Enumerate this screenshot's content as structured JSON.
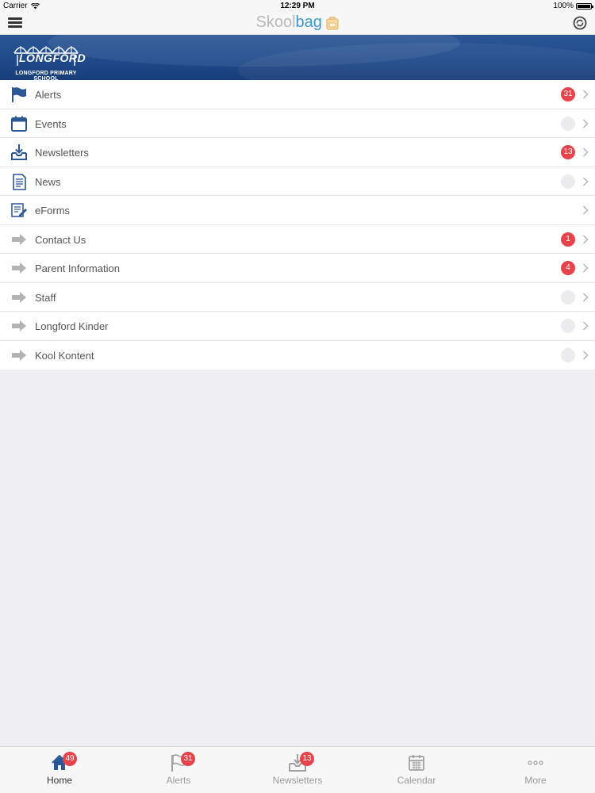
{
  "status": {
    "carrier": "Carrier",
    "time": "12:29 PM",
    "battery": "100%"
  },
  "nav": {
    "brand_skool": "Skool",
    "brand_bag": "bag"
  },
  "banner": {
    "logo_word": "LONGFORD",
    "school_name": "LONGFORD PRIMARY SCHOOL"
  },
  "menu": [
    {
      "label": "Alerts",
      "badge": "31",
      "icon": "flag-icon"
    },
    {
      "label": "Events",
      "badge": "",
      "icon": "calendar-icon"
    },
    {
      "label": "Newsletters",
      "badge": "13",
      "icon": "inbox-download-icon"
    },
    {
      "label": "News",
      "badge": "",
      "icon": "document-icon"
    },
    {
      "label": "eForms",
      "badge": null,
      "icon": "form-edit-icon"
    },
    {
      "label": "Contact Us",
      "badge": "1",
      "icon": "arrow-right-icon"
    },
    {
      "label": "Parent Information",
      "badge": "4",
      "icon": "arrow-right-icon"
    },
    {
      "label": "Staff",
      "badge": "",
      "icon": "arrow-right-icon"
    },
    {
      "label": "Longford Kinder",
      "badge": "",
      "icon": "arrow-right-icon"
    },
    {
      "label": "Kool Kontent",
      "badge": "",
      "icon": "arrow-right-icon"
    }
  ],
  "tabs": [
    {
      "label": "Home",
      "badge": "49",
      "icon": "home-icon",
      "active": true
    },
    {
      "label": "Alerts",
      "badge": "31",
      "icon": "flag-icon",
      "active": false
    },
    {
      "label": "Newsletters",
      "badge": "13",
      "icon": "inbox-download-icon",
      "active": false
    },
    {
      "label": "Calendar",
      "badge": null,
      "icon": "calendar-icon",
      "active": false
    },
    {
      "label": "More",
      "badge": null,
      "icon": "more-dots-icon",
      "active": false
    }
  ],
  "colors": {
    "accent": "#2b5797",
    "badge": "#e8434a",
    "brand_bag": "#3a9bc9"
  }
}
